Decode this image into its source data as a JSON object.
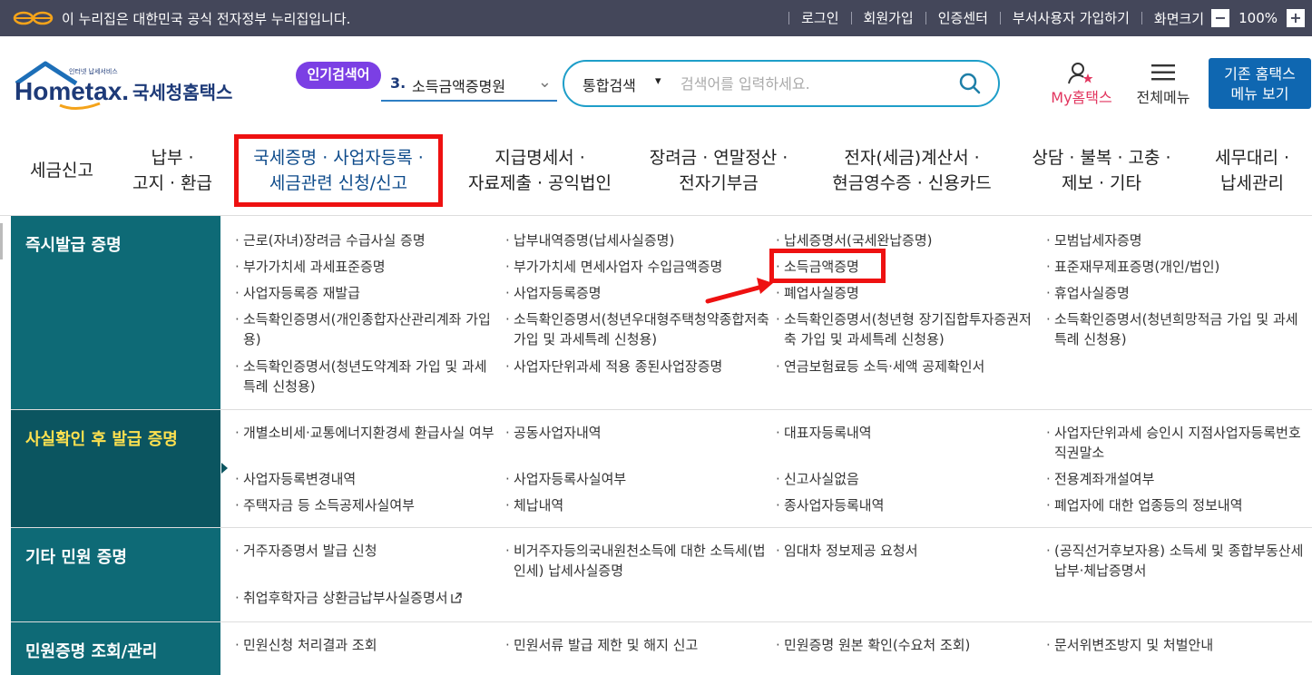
{
  "govbar": {
    "notice": "이 누리집은 대한민국 공식 전자정부 누리집입니다.",
    "links": [
      "로그인",
      "회원가입",
      "인증센터",
      "부서사용자 가입하기"
    ],
    "zoom_label": "화면크기",
    "zoom_minus": "−",
    "zoom_value": "100%",
    "zoom_plus": "+"
  },
  "header": {
    "logo_text": "Hometax.",
    "logo_kr": "국세청홈택스",
    "logo_tiny": "인터넷 납세서비스",
    "popular_label": "인기검색어",
    "popular_num": "3.",
    "popular_term": "소득금액증명원",
    "search_scope": "통합검색",
    "search_placeholder": "검색어를 입력하세요.",
    "myhome": "My홈택스",
    "allmenu": "전체메뉴",
    "legacy_line1": "기존 홈택스",
    "legacy_line2": "메뉴 보기"
  },
  "nav": [
    {
      "l1": "세금신고",
      "l2": ""
    },
    {
      "l1": "납부 ·",
      "l2": "고지 · 환급"
    },
    {
      "l1": "국세증명 · 사업자등록 ·",
      "l2": "세금관련 신청/신고"
    },
    {
      "l1": "지급명세서 ·",
      "l2": "자료제출 · 공익법인"
    },
    {
      "l1": "장려금 · 연말정산 ·",
      "l2": "전자기부금"
    },
    {
      "l1": "전자(세금)계산서 ·",
      "l2": "현금영수증 · 신용카드"
    },
    {
      "l1": "상담 · 불복 · 고충 ·",
      "l2": "제보 · 기타"
    },
    {
      "l1": "세무대리 ·",
      "l2": "납세관리"
    }
  ],
  "sections": [
    {
      "title": "즉시발급 증명",
      "links": [
        "근로(자녀)장려금 수급사실 증명",
        "납부내역증명(납세사실증명)",
        "납세증명서(국세완납증명)",
        "모범납세자증명",
        "부가가치세 과세표준증명",
        "부가가치세 면세사업자 수입금액증명",
        "소득금액증명",
        "표준재무제표증명(개인/법인)",
        "사업자등록증 재발급",
        "사업자등록증명",
        "폐업사실증명",
        "휴업사실증명",
        "소득확인증명서(개인종합자산관리계좌 가입용)",
        "소득확인증명서(청년우대형주택청약종합저축 가입 및 과세특례 신청용)",
        "소득확인증명서(청년형 장기집합투자증권저축 가입 및 과세특례 신청용)",
        "소득확인증명서(청년희망적금 가입 및 과세특례 신청용)",
        "소득확인증명서(청년도약계좌 가입 및 과세특례 신청용)",
        "사업자단위과세 적용 종된사업장증명",
        "연금보험료등 소득·세액 공제확인서"
      ]
    },
    {
      "title": "사실확인 후 발급 증명",
      "links": [
        "개별소비세·교통에너지환경세 환급사실 여부",
        "공동사업자내역",
        "대표자등록내역",
        "사업자단위과세 승인시 지점사업자등록번호 직권말소",
        "사업자등록변경내역",
        "사업자등록사실여부",
        "신고사실없음",
        "전용계좌개설여부",
        "주택자금 등 소득공제사실여부",
        "체납내역",
        "종사업자등록내역",
        "폐업자에 대한 업종등의 정보내역"
      ]
    },
    {
      "title": "기타 민원 증명",
      "links": [
        "거주자증명서 발급 신청",
        "비거주자등의국내원천소득에 대한 소득세(법인세) 납세사실증명",
        "임대차 정보제공 요청서",
        "(공직선거후보자용) 소득세 및 종합부동산세 납부·체납증명서",
        "취업후학자금 상환금납부사실증명서"
      ]
    },
    {
      "title": "민원증명 조회/관리",
      "links": [
        "민원신청 처리결과 조회",
        "민원서류 발급 제한 및 해지 신고",
        "민원증명 원본 확인(수요처 조회)",
        "문서위변조방지 및 처벌안내"
      ]
    }
  ],
  "colors": {
    "govbar": "#44475a",
    "section_head": "#0e6a76",
    "highlight": "#ee1111",
    "accent_blue": "#0f67b1"
  }
}
